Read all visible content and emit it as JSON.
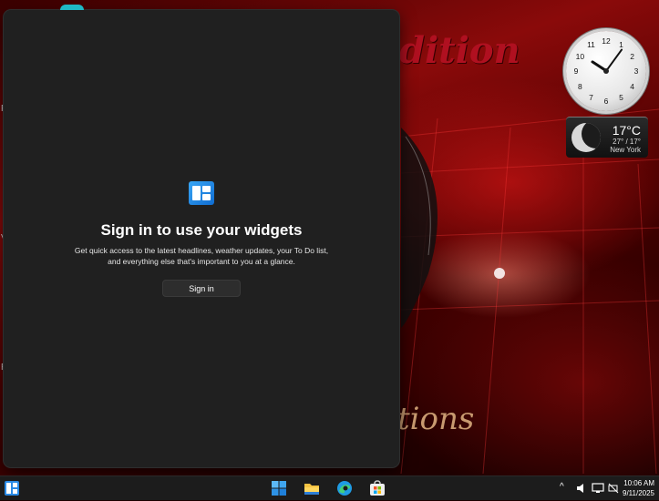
{
  "wallpaper": {
    "top_text": "dition",
    "bottom_text": "tions",
    "left_edge_chars": [
      "F",
      "V",
      "R"
    ]
  },
  "clock": {
    "numbers": [
      "12",
      "1",
      "2",
      "3",
      "4",
      "5",
      "6",
      "7",
      "8",
      "9",
      "10",
      "11"
    ],
    "time_hours": 10,
    "time_minutes": 6
  },
  "weather": {
    "temp": "17°C",
    "range": "27° / 17°",
    "city": "New York",
    "icon": "moon-icon"
  },
  "widgets_panel": {
    "title": "Sign in to use your widgets",
    "description": "Get quick access to the latest headlines, weather updates, your To Do list, and everything else that's important to you at a glance.",
    "signin_label": "Sign in",
    "icon": "widgets-icon"
  },
  "taskbar": {
    "widgets_icon": "widgets-taskbar-icon",
    "apps": [
      "start-icon",
      "file-explorer-icon",
      "edge-icon",
      "store-icon"
    ],
    "tray_chevron": "^",
    "time": "10:06 AM",
    "date": "9/11/2025"
  },
  "colors": {
    "panel_bg": "#202020",
    "accent_blue": "#0f6cd1",
    "taskbar_bg": "#1c1c1c"
  }
}
